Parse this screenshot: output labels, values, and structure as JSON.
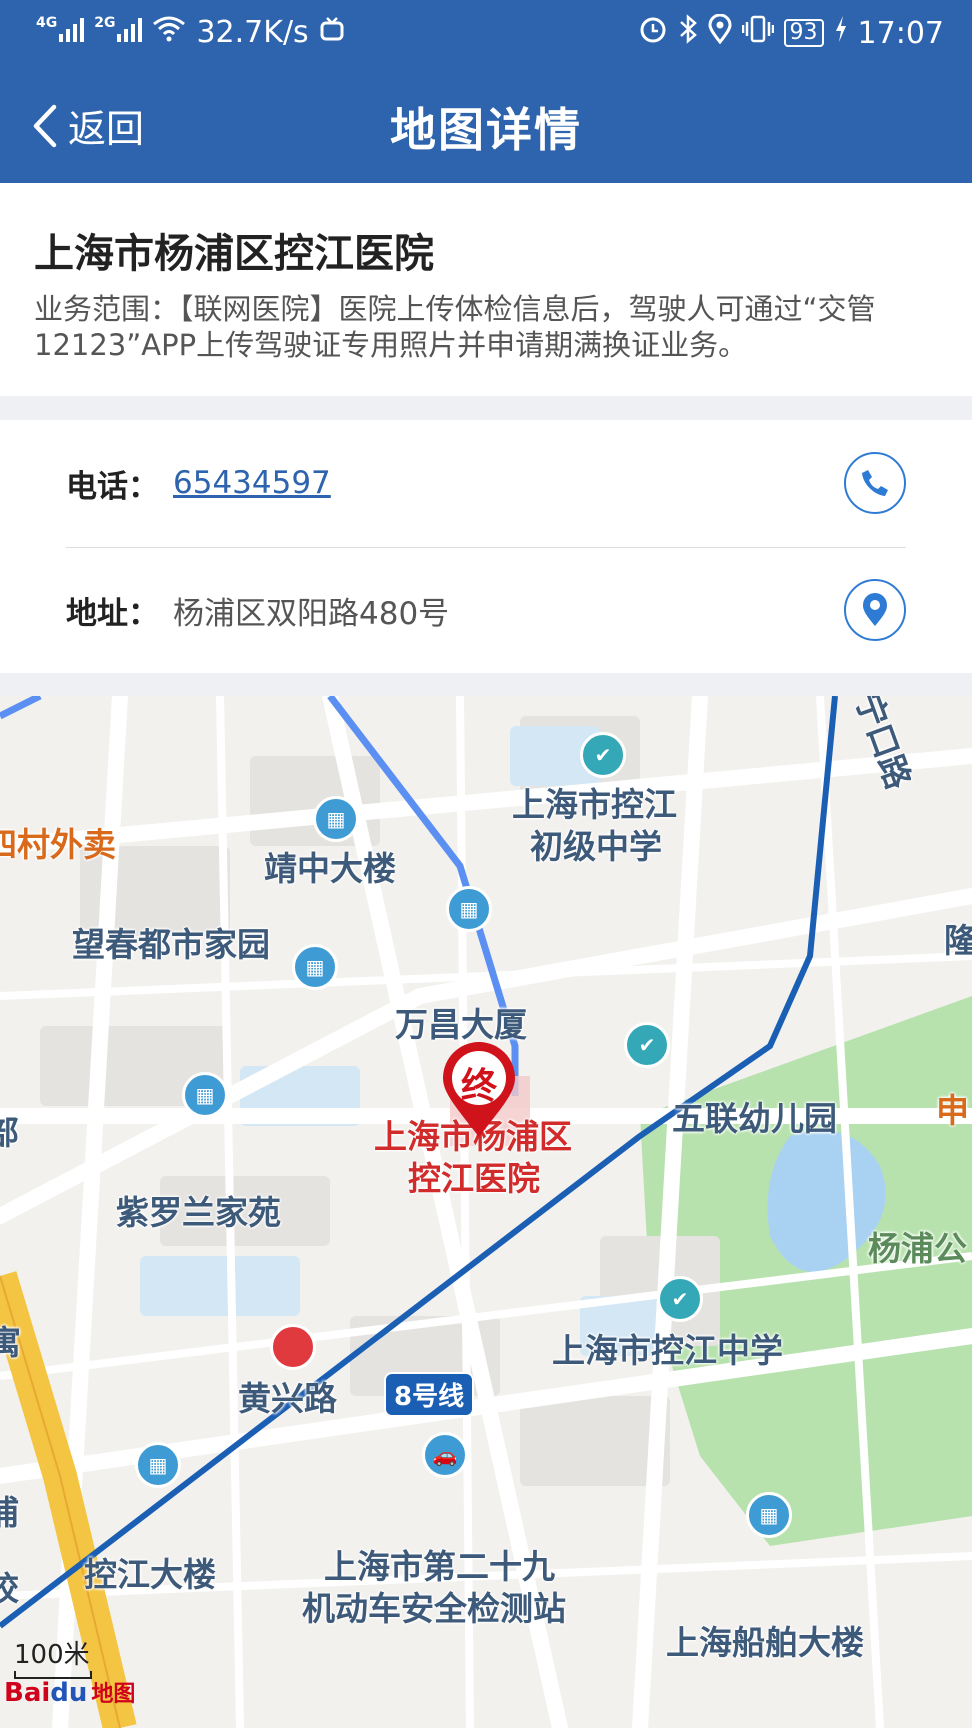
{
  "status_bar": {
    "net1": "4G",
    "net2": "2G",
    "speed": "32.7K/s",
    "battery": "93",
    "time": "17:07"
  },
  "nav": {
    "back_label": "返回",
    "title": "地图详情"
  },
  "hospital": {
    "name": "上海市杨浦区控江医院",
    "scope": "业务范围：【联网医院】医院上传体检信息后，驾驶人可通过“交管12123”APP上传驾驶证专用照片并申请期满换证业务。"
  },
  "contact": {
    "phone_label": "电话：",
    "phone_value": "65434597",
    "address_label": "地址：",
    "address_value": "杨浦区双阳路480号"
  },
  "map": {
    "labels": {
      "school_top": "上海市控江",
      "school_top2": "初级中学",
      "jingzhong": "靖中大楼",
      "waimai": "四村外卖",
      "wangchun": "望春都市家园",
      "wanchang": "万昌大厦",
      "hosp1": "上海市杨浦区",
      "hosp2": "控江医院",
      "kindergarten": "五联幼儿园",
      "zilanlan": "紫罗兰家苑",
      "park": "杨浦公",
      "line8": "8号线",
      "huangxing": "黄兴路",
      "school_mid": "上海市控江中学",
      "kongjiang_bldg": "控江大楼",
      "station1": "上海市第二十九",
      "station2": "机动车安全检测站",
      "chuanbo": "上海船舶大楼",
      "road_ne": "宁口路",
      "edge_zhong": "申",
      "edge_yu": "寓",
      "edge_bu": "部",
      "edge_long": "隆",
      "edge_pu": "浦",
      "edge_xiao": "校",
      "marker_char": "终"
    },
    "scale": "100米",
    "logo_bai": "Bai",
    "logo_du": "du",
    "logo_map": "地图"
  },
  "colors": {
    "header": "#2e64ad",
    "route": "#5b8ff2",
    "metro": "#1a5fb4",
    "marker": "#d0121b"
  }
}
